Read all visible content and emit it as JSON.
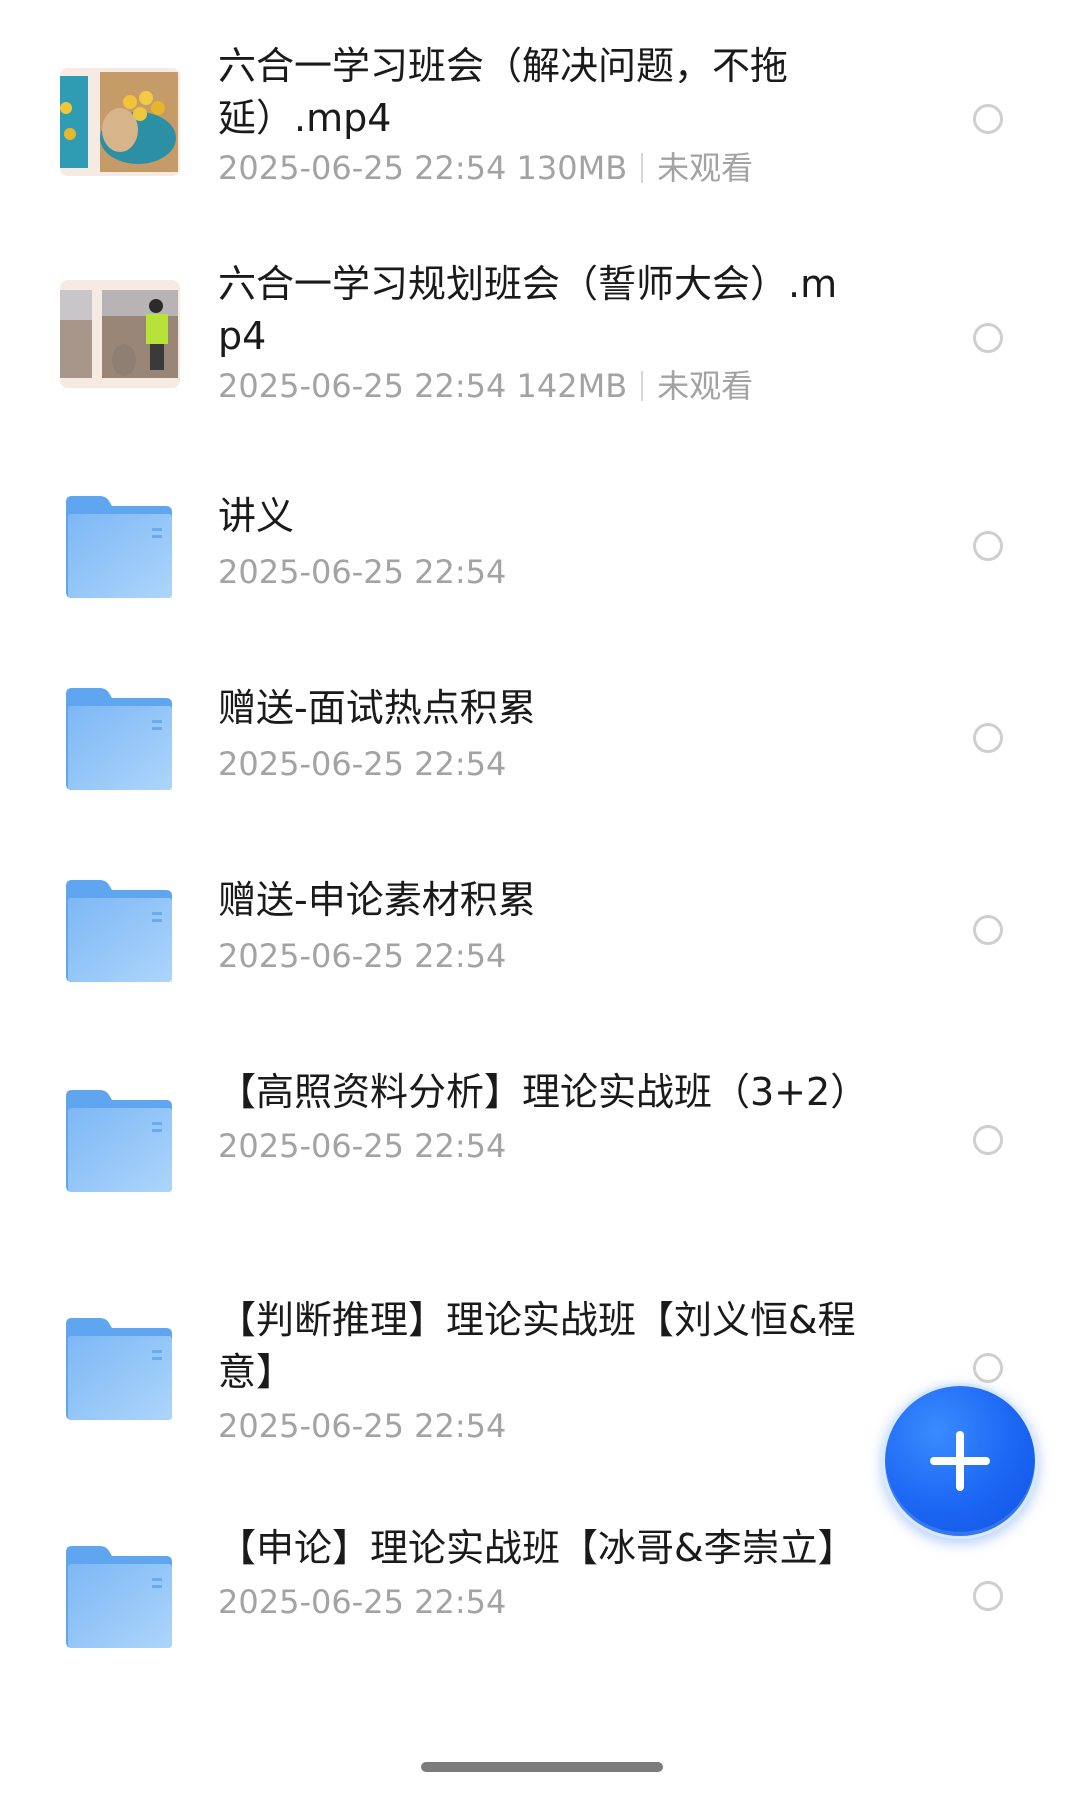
{
  "files": [
    {
      "title": "六合一学习班会（解决问题，不拖延）.mp4",
      "date": "2025-06-25 22:54",
      "size": "130MB",
      "status": "未观看",
      "kind": "video",
      "thumb_icon": "video-thumbnail-dog"
    },
    {
      "title": "六合一学习规划班会（誓师大会）.mp4",
      "date": "2025-06-25 22:54",
      "size": "142MB",
      "status": "未观看",
      "kind": "video",
      "thumb_icon": "video-thumbnail-outdoor"
    },
    {
      "title": "讲义",
      "date": "2025-06-25 22:54",
      "kind": "folder"
    },
    {
      "title": "赠送-面试热点积累",
      "date": "2025-06-25 22:54",
      "kind": "folder"
    },
    {
      "title": "赠送-申论素材积累",
      "date": "2025-06-25 22:54",
      "kind": "folder"
    },
    {
      "title": "【高照资料分析】理论实战班（3+2）",
      "date": "2025-06-25 22:54",
      "kind": "folder"
    },
    {
      "title": "【判断推理】理论实战班【刘义恒&程意】",
      "date": "2025-06-25 22:54",
      "kind": "folder"
    },
    {
      "title": "【申论】理论实战班【冰哥&李崇立】",
      "date": "2025-06-25 22:54",
      "kind": "folder"
    }
  ],
  "fab": {
    "icon": "plus-icon",
    "color": "#1b66f3"
  },
  "colors": {
    "folder": "#8ec2f7",
    "meta_text": "#a3a3a3",
    "title_text": "#1a1a1a"
  }
}
